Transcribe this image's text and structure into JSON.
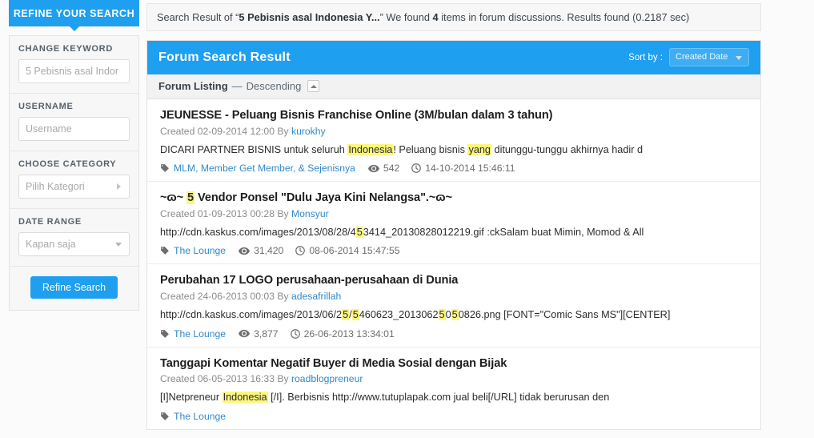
{
  "sidebar": {
    "tab_label": "REFINE YOUR SEARCH",
    "fields": [
      {
        "label": "CHANGE KEYWORD",
        "value": "5 Pebisnis asal Indor",
        "kind": "text"
      },
      {
        "label": "USERNAME",
        "value": "Username",
        "kind": "text"
      },
      {
        "label": "CHOOSE CATEGORY",
        "value": "Pilih Kategori",
        "kind": "arrow"
      },
      {
        "label": "DATE RANGE",
        "value": "Kapan saja",
        "kind": "select"
      }
    ],
    "submit_label": "Refine Search"
  },
  "summary": {
    "prefix": "Search Result of “",
    "query": "5 Pebisnis asal Indonesia Y...",
    "mid": "” We found ",
    "count": "4",
    "suffix": " items in forum discussions. Results found (0.2187 sec)"
  },
  "header": {
    "title": "Forum Search Result",
    "sort_by_label": "Sort by :",
    "sort_value": "Created Date"
  },
  "listing": {
    "label": "Forum Listing",
    "dash": "—",
    "order": "Descending"
  },
  "results": [
    {
      "title_parts": [
        {
          "t": "JEUNESSE - Peluang Bisnis Franchise Online (3M/bulan dalam 3 tahun)",
          "hl": false
        }
      ],
      "created_prefix": "Created 02-09-2014 12:00 By ",
      "author": "kurokhy",
      "snippet_parts": [
        {
          "t": "DICARI PARTNER BISNIS untuk seluruh ",
          "hl": false
        },
        {
          "t": "Indonesia",
          "hl": true
        },
        {
          "t": "! Peluang bisnis ",
          "hl": false
        },
        {
          "t": "yang",
          "hl": true
        },
        {
          "t": " ditunggu-tunggu akhirnya hadir d",
          "hl": false
        }
      ],
      "category": "MLM, Member Get Member, & Sejenisnya",
      "views": "542",
      "timestamp": "14-10-2014 15:46:11"
    },
    {
      "title_parts": [
        {
          "t": "~ɷ~ ",
          "hl": false
        },
        {
          "t": "5",
          "hl": true
        },
        {
          "t": " Vendor Ponsel \"Dulu Jaya Kini Nelangsa\".~ɷ~",
          "hl": false
        }
      ],
      "created_prefix": "Created 01-09-2013 00:28 By ",
      "author": "Monsyur",
      "snippet_parts": [
        {
          "t": "http://cdn.kaskus.com/images/2013/08/28/4",
          "hl": false
        },
        {
          "t": "5",
          "hl": true
        },
        {
          "t": "3414_20130828012219.gif :ckSalam buat Mimin, Momod & All",
          "hl": false
        }
      ],
      "category": "The Lounge",
      "views": "31,420",
      "timestamp": "08-06-2014 15:47:55"
    },
    {
      "title_parts": [
        {
          "t": "Perubahan 17 LOGO perusahaan-perusahaan di Dunia",
          "hl": false
        }
      ],
      "created_prefix": "Created 24-06-2013 00:03 By ",
      "author": "adesafrillah",
      "snippet_parts": [
        {
          "t": "http://cdn.kaskus.com/images/2013/06/2",
          "hl": false
        },
        {
          "t": "5",
          "hl": true
        },
        {
          "t": "/",
          "hl": false
        },
        {
          "t": "5",
          "hl": true
        },
        {
          "t": "460623_2013062",
          "hl": false
        },
        {
          "t": "5",
          "hl": true
        },
        {
          "t": "0",
          "hl": false
        },
        {
          "t": "5",
          "hl": true
        },
        {
          "t": "0826.png [FONT=\"Comic Sans MS\"][CENTER]",
          "hl": false
        }
      ],
      "category": "The Lounge",
      "views": "3,877",
      "timestamp": "26-06-2013 13:34:01"
    },
    {
      "title_parts": [
        {
          "t": "Tanggapi Komentar Negatif Buyer di Media Sosial dengan Bijak",
          "hl": false
        }
      ],
      "created_prefix": "Created 06-05-2013 16:33 By ",
      "author": "roadblogpreneur",
      "snippet_parts": [
        {
          "t": "[I]Netpreneur ",
          "hl": false
        },
        {
          "t": "Indonesia",
          "hl": true
        },
        {
          "t": " [/I]. Berbisnis http://www.tutuplapak.com jual beli[/URL] tidak berurusan den",
          "hl": false
        }
      ],
      "category": "The Lounge",
      "views": "",
      "timestamp": ""
    }
  ],
  "colors": {
    "accent": "#1f9ff0",
    "highlight": "#fbf67c",
    "link": "#3189c9"
  }
}
